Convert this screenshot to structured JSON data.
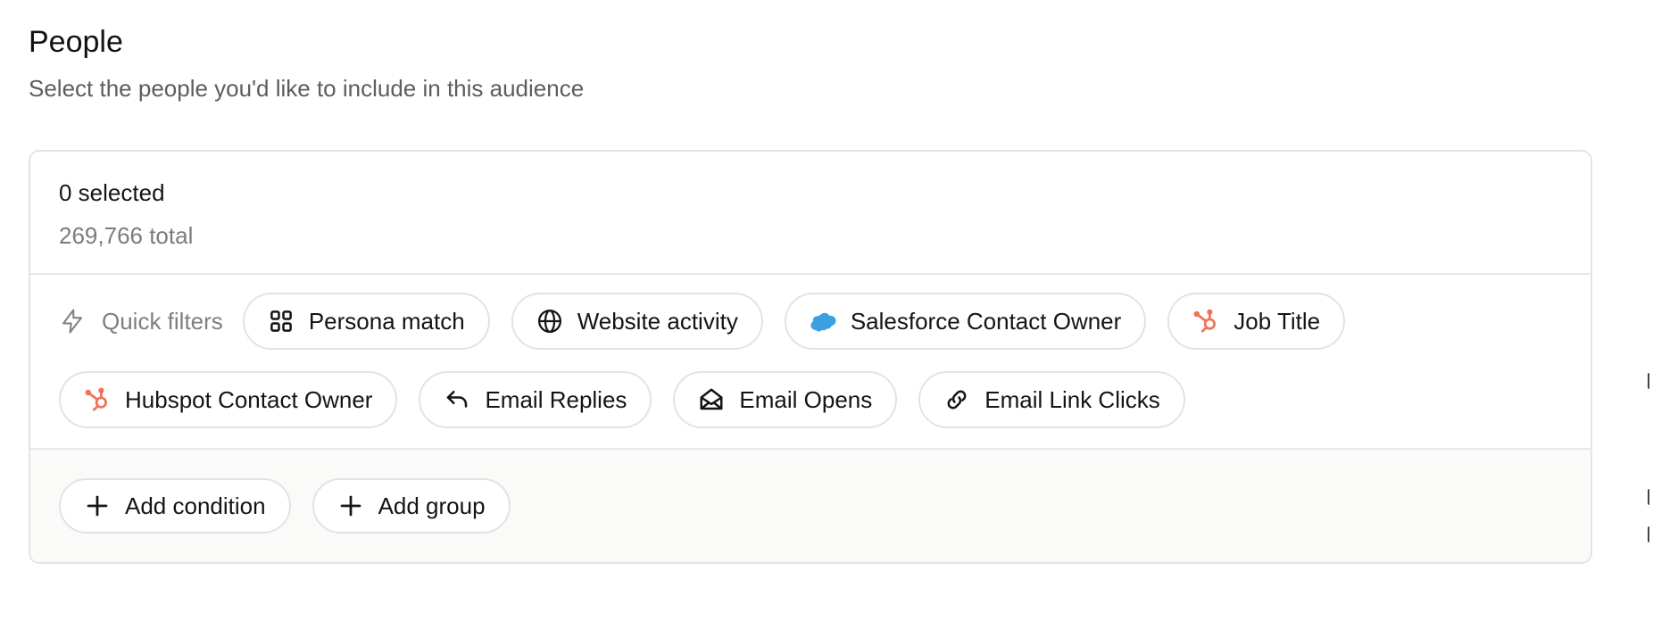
{
  "header": {
    "title": "People",
    "subtitle": "Select the people you'd like to include in this audience"
  },
  "summary": {
    "selected": "0 selected",
    "total": "269,766 total"
  },
  "quick_filters": {
    "label": "Quick filters",
    "row1": [
      {
        "label": "Persona match",
        "icon": "grid-icon"
      },
      {
        "label": "Website activity",
        "icon": "globe-icon"
      },
      {
        "label": "Salesforce Contact Owner",
        "icon": "salesforce-icon"
      },
      {
        "label": "Job Title",
        "icon": "hubspot-icon"
      }
    ],
    "row2": [
      {
        "label": "Hubspot Contact Owner",
        "icon": "hubspot-icon"
      },
      {
        "label": "Email Replies",
        "icon": "reply-icon"
      },
      {
        "label": "Email Opens",
        "icon": "envelope-open-icon"
      },
      {
        "label": "Email Link Clicks",
        "icon": "link-icon"
      }
    ]
  },
  "actions": {
    "add_condition": "Add condition",
    "add_group": "Add group"
  },
  "colors": {
    "hubspot": "#f0735a",
    "salesforce": "#3c9fe0",
    "border": "#e3e3e3",
    "muted": "#7f7f7f"
  }
}
